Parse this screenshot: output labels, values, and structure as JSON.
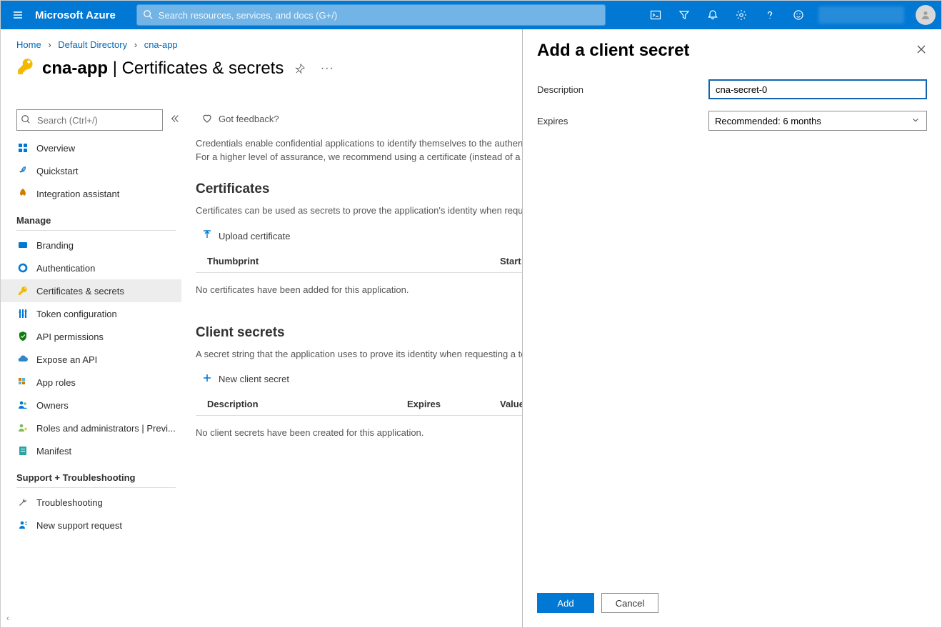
{
  "header": {
    "brand": "Microsoft Azure",
    "search_placeholder": "Search resources, services, and docs (G+/)"
  },
  "breadcrumb": {
    "home": "Home",
    "dir": "Default Directory",
    "app": "cna-app"
  },
  "title": {
    "app": "cna-app",
    "section": "Certificates & secrets"
  },
  "sidebar": {
    "search_placeholder": "Search (Ctrl+/)",
    "items_top": [
      {
        "label": "Overview"
      },
      {
        "label": "Quickstart"
      },
      {
        "label": "Integration assistant"
      }
    ],
    "manage_heading": "Manage",
    "items_manage": [
      {
        "label": "Branding"
      },
      {
        "label": "Authentication"
      },
      {
        "label": "Certificates & secrets"
      },
      {
        "label": "Token configuration"
      },
      {
        "label": "API permissions"
      },
      {
        "label": "Expose an API"
      },
      {
        "label": "App roles"
      },
      {
        "label": "Owners"
      },
      {
        "label": "Roles and administrators | Previ..."
      },
      {
        "label": "Manifest"
      }
    ],
    "support_heading": "Support + Troubleshooting",
    "items_support": [
      {
        "label": "Troubleshooting"
      },
      {
        "label": "New support request"
      }
    ]
  },
  "main": {
    "feedback": "Got feedback?",
    "intro": "Credentials enable confidential applications to identify themselves to the authentication service when receiving tokens at a web addressable location (using an HTTPS scheme). For a higher level of assurance, we recommend using a certificate (instead of a client secret) as a credential.",
    "certs_heading": "Certificates",
    "certs_desc": "Certificates can be used as secrets to prove the application's identity when requesting a token. Also can be referred to as public keys.",
    "upload_cert": "Upload certificate",
    "certs_th1": "Thumbprint",
    "certs_th2": "Start date",
    "certs_empty": "No certificates have been added for this application.",
    "secrets_heading": "Client secrets",
    "secrets_desc": "A secret string that the application uses to prove its identity when requesting a token. Also can be referred to as application password.",
    "new_secret": "New client secret",
    "secrets_th1": "Description",
    "secrets_th2": "Expires",
    "secrets_th3": "Value",
    "secrets_empty": "No client secrets have been created for this application."
  },
  "panel": {
    "title": "Add a client secret",
    "desc_label": "Description",
    "desc_value": "cna-secret-0",
    "exp_label": "Expires",
    "exp_value": "Recommended: 6 months",
    "add": "Add",
    "cancel": "Cancel"
  }
}
